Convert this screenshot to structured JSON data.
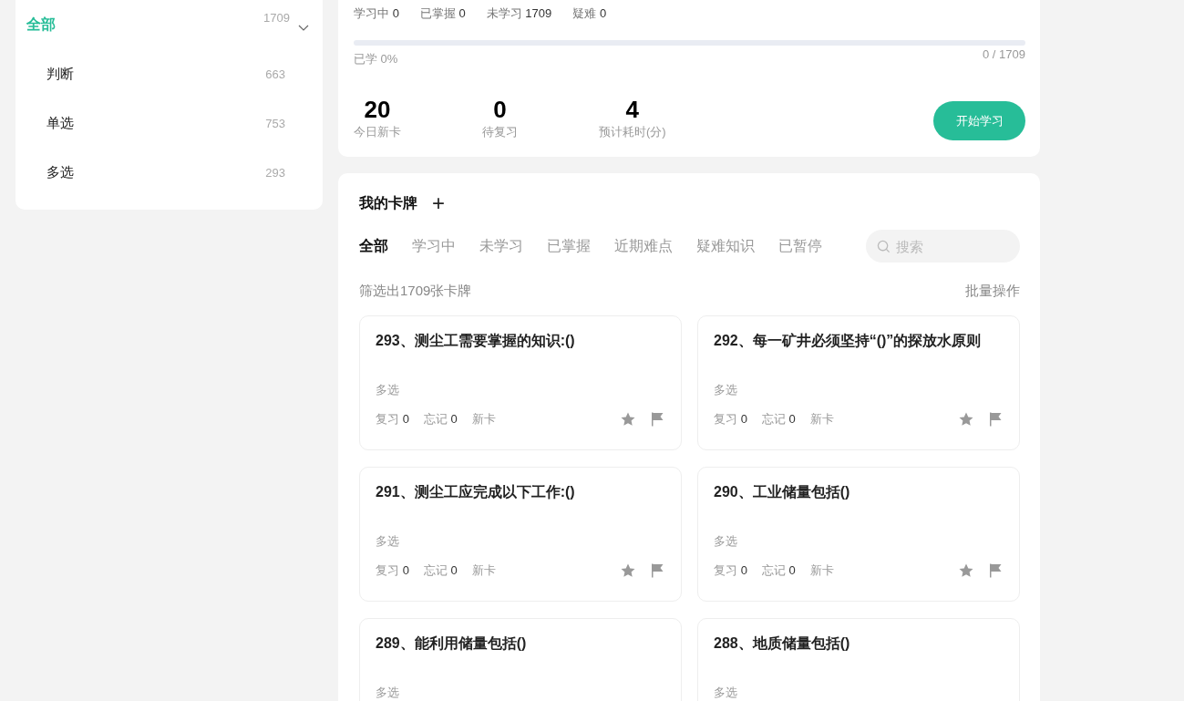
{
  "sidebar": {
    "items": [
      {
        "label": "全部",
        "count": "1709",
        "selected": true,
        "expanded": true,
        "children": [
          {
            "label": "判断",
            "count": "663",
            "selected": false
          },
          {
            "label": "单选",
            "count": "753",
            "selected": false
          },
          {
            "label": "多选",
            "count": "293",
            "selected": false
          }
        ]
      }
    ]
  },
  "overview": {
    "stats": [
      {
        "label": "学习中",
        "value": "0"
      },
      {
        "label": "已掌握",
        "value": "0"
      },
      {
        "label": "未学习",
        "value": "1709"
      },
      {
        "label": "疑难",
        "value": "0"
      }
    ],
    "progress": {
      "level": 0,
      "caption": "已学 0%",
      "reading": "0 / 1709"
    },
    "today": [
      {
        "value": "20",
        "label": "今日新卡"
      },
      {
        "value": "0",
        "label": "待复习"
      },
      {
        "value": "4",
        "label": "预计耗时(分)"
      }
    ],
    "start_button": "开始学习"
  },
  "cards_panel": {
    "title": "我的卡牌",
    "add_button": "+",
    "tabs": [
      {
        "label": "全部",
        "selected": true
      },
      {
        "label": "学习中",
        "selected": false
      },
      {
        "label": "未学习",
        "selected": false
      },
      {
        "label": "已掌握",
        "selected": false
      },
      {
        "label": "近期难点",
        "selected": false
      },
      {
        "label": "疑难知识",
        "selected": false
      },
      {
        "label": "已暂停",
        "selected": false
      }
    ],
    "search": {
      "placeholder": "搜索"
    },
    "filter_summary": "筛选出1709张卡牌",
    "batch_button": "批量操作",
    "cards": [
      {
        "title": "293、测尘工需要掌握的知识:()",
        "type": "多选",
        "review_label": "复习",
        "review": "0",
        "forget_label": "忘记",
        "forget": "0",
        "status": "新卡"
      },
      {
        "title": "292、每一矿井必须坚持“()”的探放水原则",
        "type": "多选",
        "review_label": "复习",
        "review": "0",
        "forget_label": "忘记",
        "forget": "0",
        "status": "新卡"
      },
      {
        "title": "291、测尘工应完成以下工作:()",
        "type": "多选",
        "review_label": "复习",
        "review": "0",
        "forget_label": "忘记",
        "forget": "0",
        "status": "新卡"
      },
      {
        "title": "290、工业储量包括()",
        "type": "多选",
        "review_label": "复习",
        "review": "0",
        "forget_label": "忘记",
        "forget": "0",
        "status": "新卡"
      },
      {
        "title": "289、能利用储量包括()",
        "type": "多选"
      },
      {
        "title": "288、地质储量包括()",
        "type": "多选"
      }
    ]
  }
}
